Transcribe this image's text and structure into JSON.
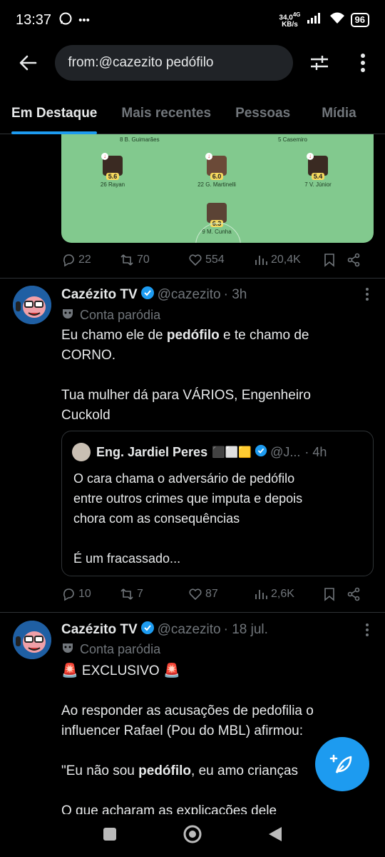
{
  "status_bar": {
    "time": "13:37",
    "speed_value": "34,0",
    "speed_unit": "KB/s",
    "network": "4G",
    "battery": "96"
  },
  "search": {
    "query": "from:@cazezito pedófilo"
  },
  "tabs": [
    {
      "label": "Em Destaque",
      "active": true
    },
    {
      "label": "Mais recentes",
      "active": false
    },
    {
      "label": "Pessoas",
      "active": false
    },
    {
      "label": "Mídia",
      "active": false
    }
  ],
  "post0": {
    "lineup": {
      "top_left": "8 B. Guimarães",
      "top_right": "5 Casemiro",
      "players": [
        {
          "rating": "5.6",
          "name": "26 Rayan"
        },
        {
          "rating": "6.0",
          "name": "22 G. Martinelli"
        },
        {
          "rating": "5.4",
          "name": "7 V. Júnior"
        },
        {
          "rating": "6.3",
          "name": "9 M. Cunha"
        }
      ]
    },
    "actions": {
      "replies": "22",
      "reposts": "70",
      "likes": "554",
      "views": "20,4K"
    }
  },
  "tweet1": {
    "name": "Cazézito TV",
    "handle": "@cazezito",
    "time": "· 3h",
    "parody": "Conta paródia",
    "line1_pre": "Eu chamo ele de ",
    "line1_bold": "pedófilo",
    "line1_post": " e te chamo de",
    "line2": "CORNO.",
    "line3": "Tua mulher dá para VÁRIOS, Engenheiro",
    "line4": "Cuckold",
    "quote": {
      "name": "Eng. Jardiel Peres",
      "flags": "⬛⬜🟨",
      "handle": "@J...",
      "time": "· 4h",
      "line1": "O cara chama o adversário de pedófilo",
      "line2": "entre outros crimes que imputa  e depois",
      "line3": "chora com as consequências",
      "line4": "É um fracassado..."
    },
    "actions": {
      "replies": "10",
      "reposts": "7",
      "likes": "87",
      "views": "2,6K"
    }
  },
  "tweet2": {
    "name": "Cazézito TV",
    "handle": "@cazezito",
    "time": "· 18 jul.",
    "parody": "Conta paródia",
    "line1": "🚨 EXCLUSIVO 🚨",
    "line2": "Ao responder as acusações de pedofilia o",
    "line3": "influencer Rafael (Pou do MBL) afirmou:",
    "line4_pre": "\"Eu não sou ",
    "line4_bold": "pedófilo",
    "line4_post": ", eu amo crianças",
    "line5": "O que acharam as explicações dele"
  },
  "colors": {
    "accent": "#1d9bf0",
    "muted": "#71767b",
    "pitch": "#82c98e"
  }
}
